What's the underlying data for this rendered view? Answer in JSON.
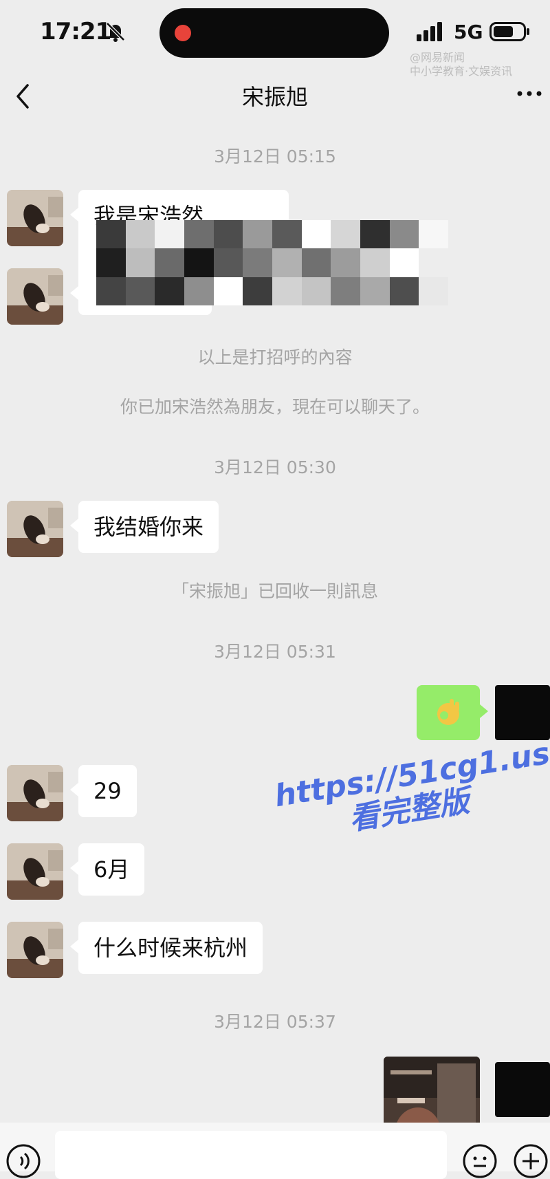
{
  "status_bar": {
    "time": "17:21",
    "network": "5G"
  },
  "watermark_top": {
    "line1": "@网易新闻",
    "line2": "中小学教育·文娱资讯"
  },
  "header": {
    "title": "宋振旭"
  },
  "messages": {
    "ts1": "3月12日 05:15",
    "greeting_line1": "我是宋浩然",
    "sys1": "以上是打招呼的內容",
    "sys2": "你已加宋浩然為朋友，現在可以聊天了。",
    "ts2": "3月12日 05:30",
    "msg_wedding": "我结婚你来",
    "sys_recall": "「宋振旭」已回收一則訊息",
    "ts3": "3月12日 05:31",
    "msg_29": "29",
    "msg_june": "6月",
    "msg_hangzhou": "什么时候来杭州",
    "ts4": "3月12日 05:37"
  },
  "overlay_watermark": {
    "line1": "https://51cg1.us",
    "line2": "看完整版"
  },
  "icons": {
    "back": "chevron-left-icon",
    "more": "more-dots-icon",
    "voice": "voice-icon",
    "emoji": "emoji-icon",
    "plus": "plus-icon",
    "mute": "bell-slash-icon"
  },
  "colors": {
    "bg": "#ededed",
    "self_bubble": "#95ec69",
    "recording": "#e8433a",
    "watermark": "#4d6fe0"
  }
}
